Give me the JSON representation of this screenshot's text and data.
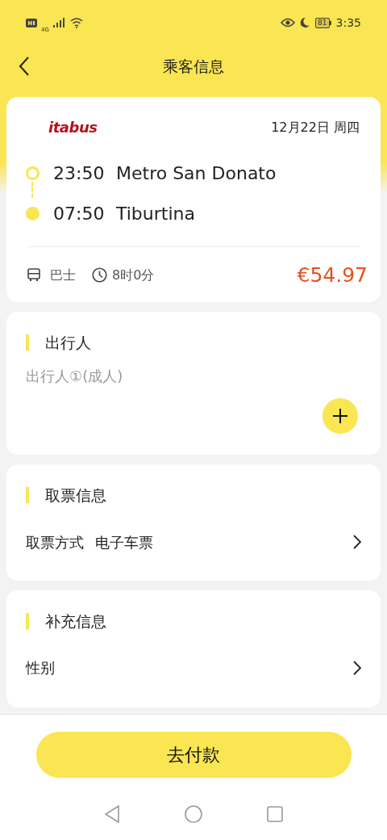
{
  "status_bar": {
    "network": "4G",
    "battery": "81",
    "time": "3:35"
  },
  "header": {
    "title": "乘客信息"
  },
  "trip": {
    "operator": "itabus",
    "date": "12月22日 周四",
    "stops": [
      {
        "kind": "departure",
        "time": "23:50",
        "place": "Metro San Donato"
      },
      {
        "kind": "arrival",
        "time": "07:50",
        "place": "Tiburtina"
      }
    ],
    "vehicle": "巴士",
    "duration": "8时0分",
    "price": "€54.97"
  },
  "travelers": {
    "title": "出行人",
    "placeholder": "出行人①(成人)"
  },
  "ticket": {
    "title": "取票信息",
    "rows": [
      {
        "label": "取票方式",
        "value": "电子车票"
      }
    ]
  },
  "extra": {
    "title": "补充信息",
    "rows": [
      {
        "label": "性别"
      }
    ]
  },
  "pay_button": "去付款"
}
